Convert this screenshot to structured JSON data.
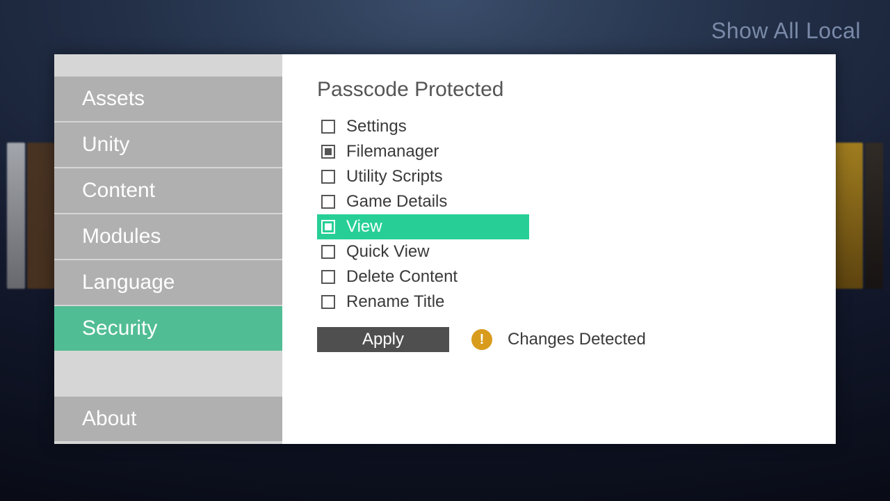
{
  "header": {
    "top_right_label": "Show All Local"
  },
  "sidebar": {
    "items": [
      {
        "label": "Assets",
        "active": false
      },
      {
        "label": "Unity",
        "active": false
      },
      {
        "label": "Content",
        "active": false
      },
      {
        "label": "Modules",
        "active": false
      },
      {
        "label": "Language",
        "active": false
      },
      {
        "label": "Security",
        "active": true
      }
    ],
    "footer_item": {
      "label": "About",
      "active": false
    }
  },
  "content": {
    "title": "Passcode Protected",
    "options": [
      {
        "label": "Settings",
        "checked": false,
        "highlight": false
      },
      {
        "label": "Filemanager",
        "checked": true,
        "highlight": false
      },
      {
        "label": "Utility Scripts",
        "checked": false,
        "highlight": false
      },
      {
        "label": "Game Details",
        "checked": false,
        "highlight": false
      },
      {
        "label": "View",
        "checked": true,
        "highlight": true
      },
      {
        "label": "Quick View",
        "checked": false,
        "highlight": false
      },
      {
        "label": "Delete Content",
        "checked": false,
        "highlight": false
      },
      {
        "label": "Rename Title",
        "checked": false,
        "highlight": false
      }
    ],
    "apply_label": "Apply",
    "status_text": "Changes Detected",
    "status_icon_glyph": "!"
  }
}
